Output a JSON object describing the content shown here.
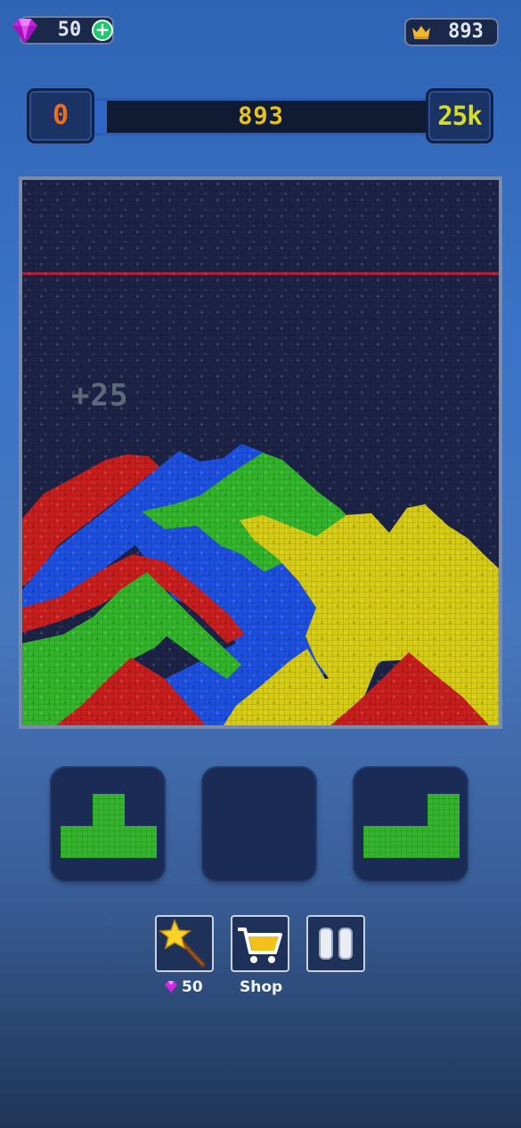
{
  "currency": {
    "gems": "50",
    "add_label": "+"
  },
  "best": {
    "score": "893"
  },
  "progress": {
    "min_label": "0",
    "score": "893",
    "max_label": "25k",
    "fraction": 0.036
  },
  "board": {
    "combo_text": "+25",
    "deadline_color": "#d8142a"
  },
  "colors": {
    "red": "#c81e1e",
    "blue": "#1d4fe0",
    "green": "#32b52a",
    "yellow": "#d6cc14"
  },
  "tray": [
    {
      "shape": "T",
      "color": "green"
    },
    {
      "shape": "empty"
    },
    {
      "shape": "J",
      "color": "green"
    }
  ],
  "tools": {
    "magic_wand": {
      "icon": "magic-wand-icon",
      "cost": "50"
    },
    "shop": {
      "icon": "shopping-cart-icon",
      "label": "Shop"
    },
    "pause": {
      "icon": "pause-icon"
    }
  }
}
